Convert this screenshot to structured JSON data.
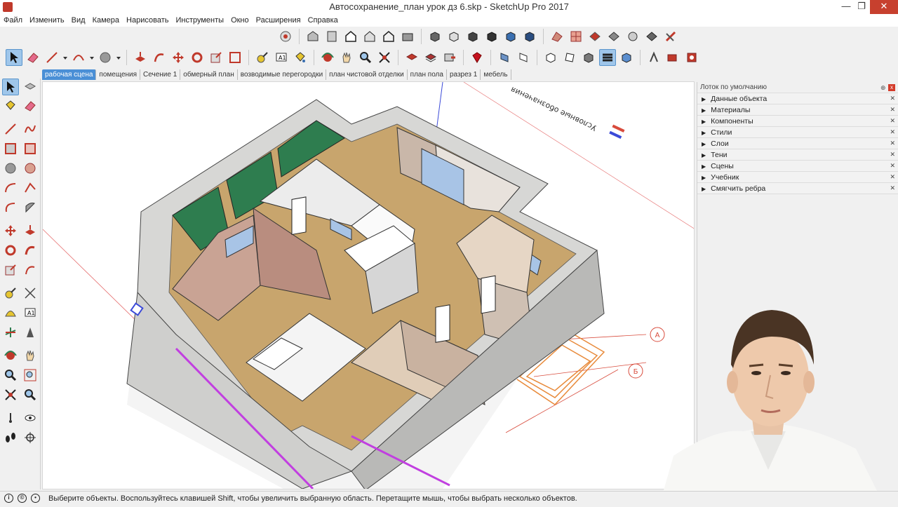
{
  "window": {
    "title": "Автосохранение_план урок  дз 6.skp - SketchUp Pro 2017",
    "minimize": "—",
    "maximize": "❐",
    "close": "✕"
  },
  "menu": [
    "Файл",
    "Изменить",
    "Вид",
    "Камера",
    "Нарисовать",
    "Инструменты",
    "Окно",
    "Расширения",
    "Справка"
  ],
  "scenes": [
    "рабочая сцена",
    "помещения",
    "Сечение 1",
    "обмерный план",
    "возводимые перегородки",
    "план чистовой отделки",
    "план пола",
    "разрез 1",
    "мебель"
  ],
  "active_scene": "рабочая сцена",
  "tray": {
    "title": "Лоток по умолчанию",
    "pin": "⊕",
    "close": "x",
    "panels": [
      "Данные объекта",
      "Материалы",
      "Компоненты",
      "Стили",
      "Слои",
      "Тени",
      "Сцены",
      "Учебник",
      "Смягчить ребра"
    ]
  },
  "status": {
    "text": "Выберите объекты. Воспользуйтесь клавишей Shift, чтобы увеличить выбранную область. Перетащите мышь, чтобы выбрать несколько объектов."
  },
  "drawing": {
    "legend_title": "Условные обозначения",
    "axis_a": "А",
    "axis_b": "Б"
  },
  "colors": {
    "wall": "#d7d7d5",
    "floor_wood": "#c8a56d",
    "green_wall": "#2e7d4f",
    "pink_wall": "#c9a394",
    "accent_blue": "#4a8fd6",
    "magenta_edge": "#c13fe0",
    "red_line": "#d84b3c"
  }
}
